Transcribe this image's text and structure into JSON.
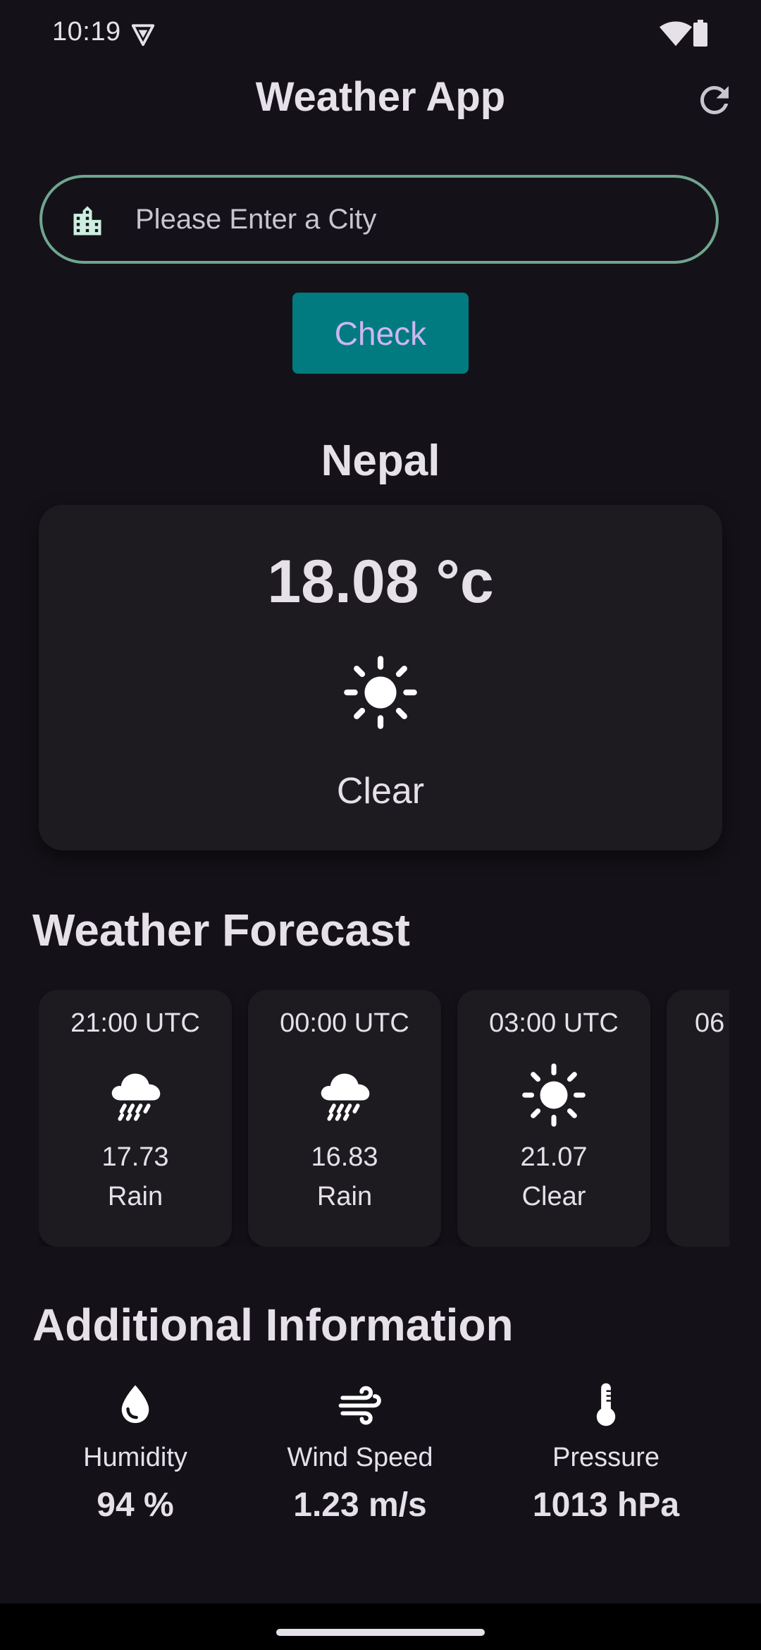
{
  "status_bar": {
    "time": "10:19",
    "icons": [
      "vpn-icon",
      "wifi-icon",
      "battery-icon"
    ]
  },
  "app_bar": {
    "title": "Weather App",
    "refresh_icon": "refresh-icon"
  },
  "search": {
    "placeholder": "Please Enter a City",
    "value": "",
    "icon": "building-icon",
    "button_label": "Check"
  },
  "current": {
    "city": "Nepal",
    "temperature": "18.08 °c",
    "condition": "Clear",
    "icon": "sun-icon"
  },
  "forecast": {
    "title": "Weather Forecast",
    "items": [
      {
        "time": "21:00 UTC",
        "temp": "17.73",
        "condition": "Rain",
        "icon": "rain-cloud-icon"
      },
      {
        "time": "00:00 UTC",
        "temp": "16.83",
        "condition": "Rain",
        "icon": "rain-cloud-icon"
      },
      {
        "time": "03:00 UTC",
        "temp": "21.07",
        "condition": "Clear",
        "icon": "sun-icon"
      },
      {
        "time": "06",
        "temp": "",
        "condition": "",
        "icon": ""
      }
    ]
  },
  "additional": {
    "title": "Additional Information",
    "items": [
      {
        "label": "Humidity",
        "value": "94 %",
        "icon": "water-drop-icon"
      },
      {
        "label": "Wind Speed",
        "value": "1.23 m/s",
        "icon": "wind-icon"
      },
      {
        "label": "Pressure",
        "value": "1013 hPa",
        "icon": "thermometer-icon"
      }
    ]
  },
  "colors": {
    "background": "#141218",
    "card": "#1d1b20",
    "accent_button": "#017b7f",
    "button_text": "#cdb6f3",
    "search_border": "#6fa58f",
    "text": "#e6e0e9"
  }
}
